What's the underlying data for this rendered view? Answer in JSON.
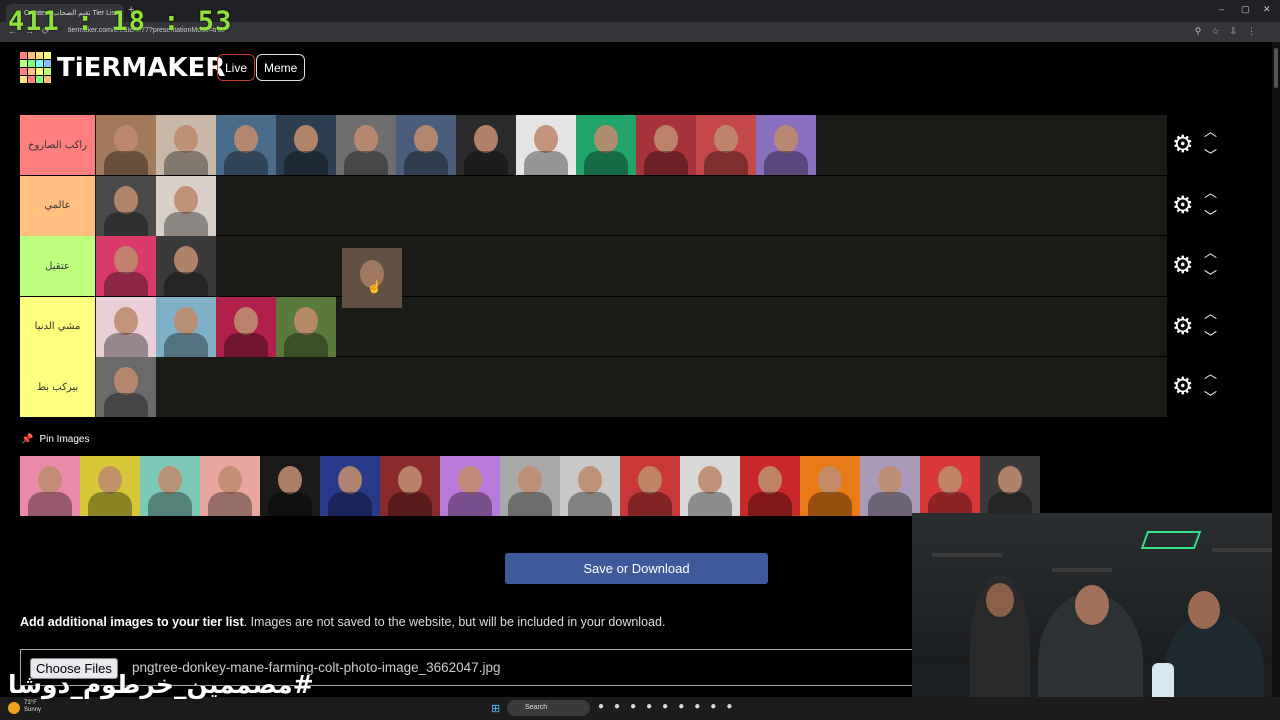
{
  "browser": {
    "tab_title": "Create a تقيم الصحاب Tier List",
    "url": "tiermaker.com/create/...77?presentationMode=true",
    "clock": "411 : 18 : 53"
  },
  "header": {
    "logo_text": "TiERMAKER",
    "live_label": "Live",
    "meme_label": "Meme",
    "logo_colors": [
      "#ff7f7f",
      "#ffbf7f",
      "#ffdf7f",
      "#ffff7f",
      "#bfff7f",
      "#7fff7f",
      "#7fffff",
      "#7fbfff",
      "#ff7f7f",
      "#ffbf7f",
      "#ffff7f",
      "#bfff7f",
      "#ffdf7f",
      "#ff7f7f",
      "#7fff7f",
      "#ffbf7f"
    ]
  },
  "tiers": [
    {
      "label": "راكب الصاروخ",
      "color": "#ff7f7f",
      "items": [
        "#a07a5a",
        "#c9b8a8",
        "#4a6b8a",
        "#2c3e50",
        "#6e6e6e",
        "#4a5d7a",
        "#2b2b2b",
        "#e5e5e5",
        "#22a36a",
        "#a8323a",
        "#c44848",
        "#8b6fbf"
      ]
    },
    {
      "label": "عالمي",
      "color": "#ffbf7f",
      "items": [
        "#4a4a4a",
        "#d8d0c8"
      ]
    },
    {
      "label": "عتقيل",
      "color": "#bfff7f",
      "items": [
        "#d93a6a",
        "#3a3a3a"
      ]
    },
    {
      "label": "مشي الدنيا",
      "color": "#ffff7f",
      "items": [
        "#e8cfd8",
        "#7fb0c8",
        "#b0204a",
        "#5a7a3a"
      ]
    },
    {
      "label": "بيركب بط",
      "color": "#ffff7f",
      "items": [
        "#6a6a6a"
      ]
    }
  ],
  "pin_label": "Pin Images",
  "pool_items": [
    "#e88aa8",
    "#d6c838",
    "#7ec8b8",
    "#e8a8a0",
    "#1a1a1a",
    "#2a3a8a",
    "#8a2a2a",
    "#b87ad8",
    "#a8a8a8",
    "#c8c8c8",
    "#c83838",
    "#d8d8d8",
    "#c82828",
    "#e87a18",
    "#a89ab8",
    "#d83838",
    "#3a3a3a"
  ],
  "save_button": "Save or Download",
  "add_images": {
    "bold": "Add additional images to your tier list",
    "rest": ". Images are not saved to the website, but will be included in your download."
  },
  "file_input": {
    "button": "Choose Files",
    "file_name": "pngtree-donkey-mane-farming-colt-photo-image_3662047.jpg"
  },
  "overlay_hashtag": "#مصممين_خرطوم_دوشا",
  "taskbar": {
    "weather_temp": "73°F",
    "weather_desc": "Sunny",
    "search_label": "Search"
  }
}
